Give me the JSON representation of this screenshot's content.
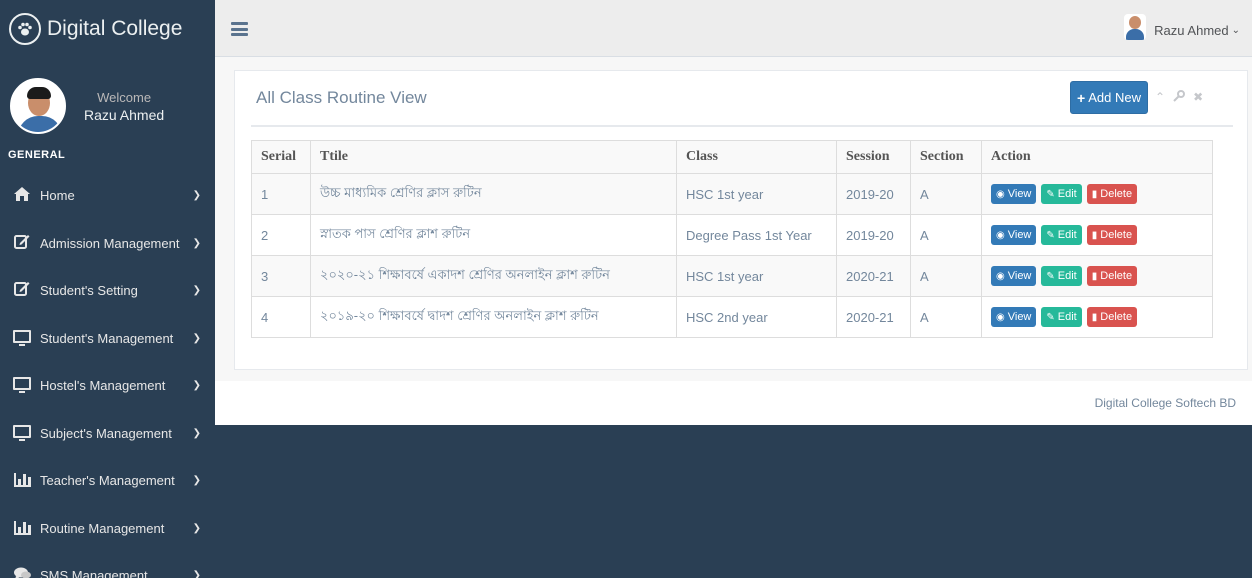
{
  "brand": {
    "logo_icon": "paw-icon",
    "name": "Digital College"
  },
  "profile": {
    "welcome": "Welcome",
    "name": "Razu Ahmed"
  },
  "sidebar": {
    "section_title": "GENERAL",
    "items": [
      {
        "label": "Home",
        "icon": "home-icon"
      },
      {
        "label": "Admission Management",
        "icon": "edit-icon"
      },
      {
        "label": "Student's Setting",
        "icon": "edit-icon"
      },
      {
        "label": "Student's Management",
        "icon": "desktop-icon"
      },
      {
        "label": "Hostel's Management",
        "icon": "desktop-icon"
      },
      {
        "label": "Subject's Management",
        "icon": "desktop-icon"
      },
      {
        "label": "Teacher's Management",
        "icon": "bar-chart-icon"
      },
      {
        "label": "Routine Management",
        "icon": "bar-chart-icon"
      },
      {
        "label": "SMS Management",
        "icon": "comments-icon"
      }
    ]
  },
  "topnav": {
    "user_name": "Razu Ahmed"
  },
  "panel": {
    "title": "All Class Routine View",
    "add_button": "Add New"
  },
  "table": {
    "headers": [
      "Serial",
      "Ttile",
      "Class",
      "Session",
      "Section",
      "Action"
    ],
    "rows": [
      {
        "serial": "1",
        "title": "উচ্চ মাধ্যমিক শ্রেণির ক্লাস রুটিন",
        "class": "HSC 1st year",
        "session": "2019-20",
        "section": "A"
      },
      {
        "serial": "2",
        "title": "স্নাতক পাস শ্রেণির ক্লাশ রুটিন",
        "class": "Degree Pass 1st Year",
        "session": "2019-20",
        "section": "A"
      },
      {
        "serial": "3",
        "title": "২০২০-২১ শিক্ষাবর্ষে একাদশ শ্রেণির অনলাইন ক্লাশ রুটিন",
        "class": "HSC 1st year",
        "session": "2020-21",
        "section": "A"
      },
      {
        "serial": "4",
        "title": "২০১৯-২০ শিক্ষাবর্ষে দ্বাদশ শ্রেণির অনলাইন ক্লাশ রুটিন",
        "class": "HSC 2nd year",
        "session": "2020-21",
        "section": "A"
      }
    ],
    "actions": {
      "view": "View",
      "edit": "Edit",
      "delete": "Delete"
    }
  },
  "footer": {
    "text": "Digital College Softech BD"
  }
}
